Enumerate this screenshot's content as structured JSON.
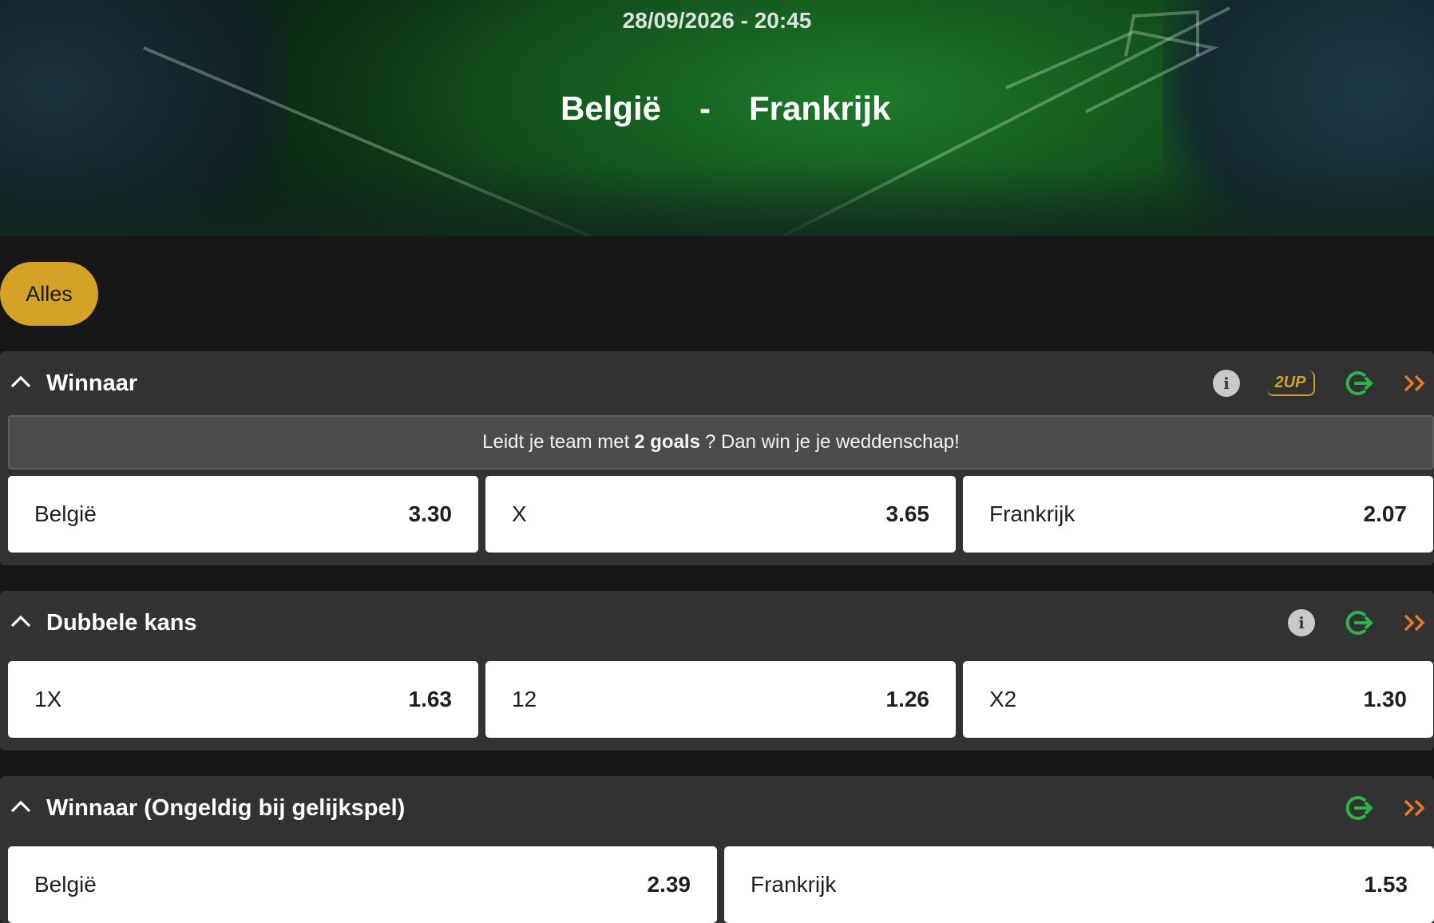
{
  "match": {
    "datetime": "28/09/2026 - 20:45",
    "home": "België",
    "separator": "-",
    "away": "Frankrijk"
  },
  "filters": {
    "active": "Alles"
  },
  "markets": [
    {
      "title": "Winnaar",
      "icons": [
        "info-icon",
        "2up-badge",
        "share-icon",
        "double-chevron-icon"
      ],
      "badge_text": "2UP",
      "info_text": "i",
      "promo": {
        "before": "Leidt je team met",
        "bold": "2 goals",
        "after": "? Dan win je je weddenschap!"
      },
      "odds": [
        {
          "label": "België",
          "value": "3.30"
        },
        {
          "label": "X",
          "value": "3.65"
        },
        {
          "label": "Frankrijk",
          "value": "2.07"
        }
      ]
    },
    {
      "title": "Dubbele kans",
      "icons": [
        "info-icon",
        "share-icon",
        "double-chevron-icon"
      ],
      "info_text": "i",
      "odds": [
        {
          "label": "1X",
          "value": "1.63"
        },
        {
          "label": "12",
          "value": "1.26"
        },
        {
          "label": "X2",
          "value": "1.30"
        }
      ]
    },
    {
      "title": "Winnaar (Ongeldig bij gelijkspel)",
      "icons": [
        "share-icon",
        "double-chevron-icon"
      ],
      "odds": [
        {
          "label": "België",
          "value": "2.39"
        },
        {
          "label": "Frankrijk",
          "value": "1.53"
        }
      ]
    }
  ],
  "colors": {
    "accent": "#d4a227",
    "share_green": "#2fb44a",
    "chevron_orange": "#e8782a",
    "panel": "#323232",
    "background": "#171717"
  }
}
